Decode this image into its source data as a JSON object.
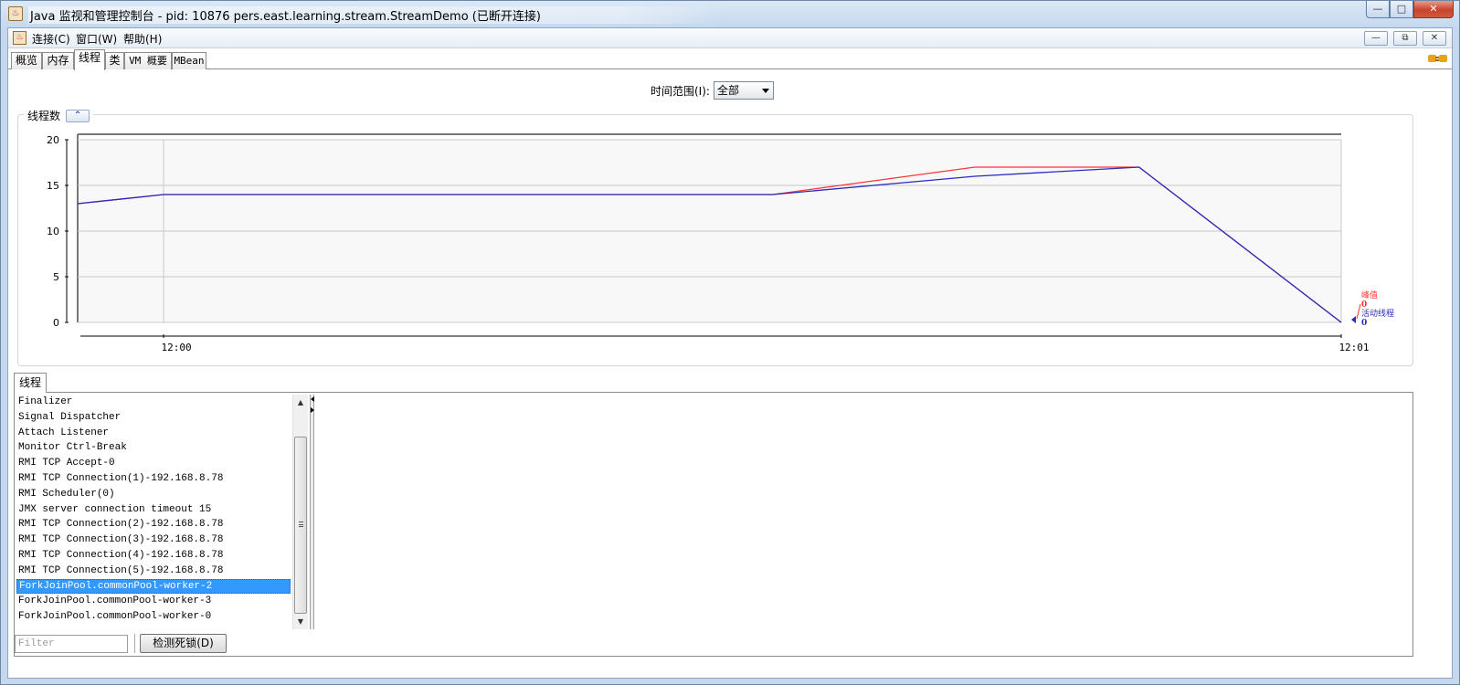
{
  "window": {
    "title": "Java 监视和管理控制台 - pid: 10876 pers.east.learning.stream.StreamDemo (已断开连接)",
    "app_icon": "java-coffee-icon",
    "controls": {
      "minimize": "—",
      "maximize": "□",
      "close": "✕"
    }
  },
  "menubar": {
    "items": [
      "连接(C)",
      "窗口(W)",
      "帮助(H)"
    ],
    "mdi_controls": {
      "minimize": "—",
      "restore": "⧉",
      "close": "✕"
    }
  },
  "tabs": {
    "items": [
      "概览",
      "内存",
      "线程",
      "类",
      "VM 概要",
      "MBean"
    ],
    "active": "线程",
    "status_icon": "disconnected-plug-icon"
  },
  "time_range": {
    "label": "时间范围(I):",
    "value": "全部"
  },
  "chart_panel": {
    "title": "线程数",
    "collapse_icon": "collapse-up-icon",
    "collapse_glyph": "⌃"
  },
  "chart_data": {
    "type": "line",
    "title": "线程数",
    "ylim": [
      0,
      20
    ],
    "y_ticks": [
      "0",
      "5",
      "10",
      "15",
      "20"
    ],
    "x_ticks": [
      "12:00",
      "12:01"
    ],
    "grid": true,
    "legend": "right",
    "colors": {
      "peak": "#ff3333",
      "live": "#2b2bbf"
    },
    "series": [
      {
        "name": "峰值",
        "current_value": "0",
        "points": [
          [
            0,
            13
          ],
          [
            0.068,
            14
          ],
          [
            0.55,
            14
          ],
          [
            0.71,
            17
          ],
          [
            0.84,
            17
          ],
          [
            1.0,
            0
          ]
        ]
      },
      {
        "name": "活动线程",
        "current_value": "0",
        "points": [
          [
            0,
            13
          ],
          [
            0.068,
            14
          ],
          [
            0.55,
            14
          ],
          [
            0.71,
            16
          ],
          [
            0.84,
            17
          ],
          [
            1.0,
            0
          ]
        ]
      }
    ]
  },
  "threads_tab": {
    "label": "线程"
  },
  "threads": {
    "items": [
      "Finalizer",
      "Signal Dispatcher",
      "Attach Listener",
      "Monitor Ctrl-Break",
      "RMI TCP Accept-0",
      "RMI TCP Connection(1)-192.168.8.78",
      "RMI Scheduler(0)",
      "JMX server connection timeout 15",
      "RMI TCP Connection(2)-192.168.8.78",
      "RMI TCP Connection(3)-192.168.8.78",
      "RMI TCP Connection(4)-192.168.8.78",
      "RMI TCP Connection(5)-192.168.8.78",
      "ForkJoinPool.commonPool-worker-2",
      "ForkJoinPool.commonPool-worker-3",
      "ForkJoinPool.commonPool-worker-0"
    ],
    "selected_index": 12
  },
  "filter": {
    "placeholder": "Filter"
  },
  "detect_deadlock": {
    "label": "检测死锁(D)"
  }
}
